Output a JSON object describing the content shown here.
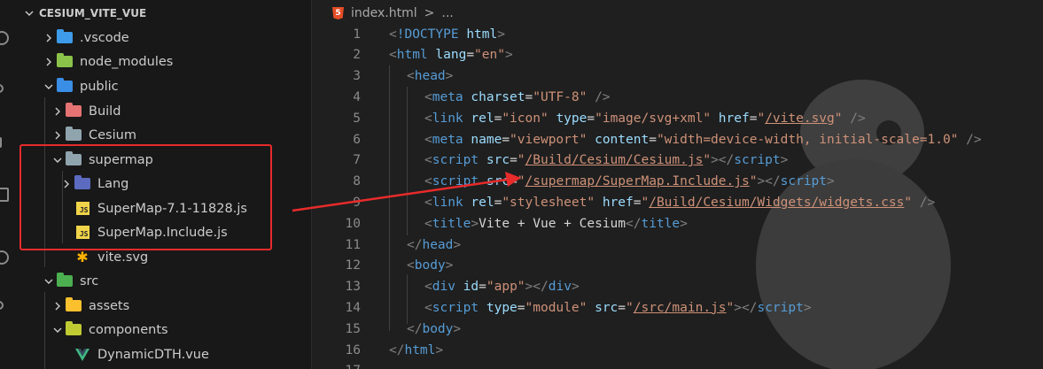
{
  "explorer": {
    "root_label": "CESIUM_VITE_VUE",
    "items": [
      {
        "label": ".vscode",
        "icon": "vscode-folder-icon",
        "chevron": "right"
      },
      {
        "label": "node_modules",
        "icon": "node-folder-icon",
        "chevron": "right"
      },
      {
        "label": "public",
        "icon": "public-folder-icon",
        "chevron": "down"
      },
      {
        "label": "Build",
        "icon": "build-folder-icon",
        "chevron": "right"
      },
      {
        "label": "Cesium",
        "icon": "folder-icon",
        "chevron": "right"
      },
      {
        "label": "supermap",
        "icon": "folder-open-icon",
        "chevron": "down"
      },
      {
        "label": "Lang",
        "icon": "lang-folder-icon",
        "chevron": "right"
      },
      {
        "label": "SuperMap-7.1-11828.js",
        "icon": "js-file-icon",
        "chevron": "none"
      },
      {
        "label": "SuperMap.Include.js",
        "icon": "js-file-icon",
        "chevron": "none"
      },
      {
        "label": "vite.svg",
        "icon": "svg-file-icon",
        "chevron": "none"
      },
      {
        "label": "src",
        "icon": "src-folder-icon",
        "chevron": "down"
      },
      {
        "label": "assets",
        "icon": "assets-folder-icon",
        "chevron": "right"
      },
      {
        "label": "components",
        "icon": "components-folder-icon",
        "chevron": "down"
      },
      {
        "label": "DynamicDTH.vue",
        "icon": "vue-file-icon",
        "chevron": "none"
      }
    ]
  },
  "editor": {
    "breadcrumb_file": "index.html",
    "breadcrumb_sep": ">",
    "breadcrumb_more": "...",
    "lines": [
      {
        "n": "1",
        "s": [
          [
            "punct",
            "<"
          ],
          [
            "tag",
            "!DOCTYPE"
          ],
          [
            "txt",
            " "
          ],
          [
            "attr",
            "html"
          ],
          [
            "punct",
            ">"
          ]
        ]
      },
      {
        "n": "2",
        "s": [
          [
            "punct",
            "<"
          ],
          [
            "tag",
            "html"
          ],
          [
            "txt",
            " "
          ],
          [
            "attr",
            "lang"
          ],
          [
            "txt",
            "="
          ],
          [
            "val",
            "\"en\""
          ],
          [
            "punct",
            ">"
          ]
        ]
      },
      {
        "n": "3",
        "s": [
          [
            "punct",
            "<"
          ],
          [
            "tag",
            "head"
          ],
          [
            "punct",
            ">"
          ]
        ]
      },
      {
        "n": "4",
        "s": [
          [
            "punct",
            "<"
          ],
          [
            "tag",
            "meta"
          ],
          [
            "txt",
            " "
          ],
          [
            "attr",
            "charset"
          ],
          [
            "txt",
            "="
          ],
          [
            "val",
            "\"UTF-8\""
          ],
          [
            "txt",
            " "
          ],
          [
            "punct",
            "/>"
          ]
        ]
      },
      {
        "n": "5",
        "s": [
          [
            "punct",
            "<"
          ],
          [
            "tag",
            "link"
          ],
          [
            "txt",
            " "
          ],
          [
            "attr",
            "rel"
          ],
          [
            "txt",
            "="
          ],
          [
            "val",
            "\"icon\""
          ],
          [
            "txt",
            " "
          ],
          [
            "attr",
            "type"
          ],
          [
            "txt",
            "="
          ],
          [
            "val",
            "\"image/svg+xml\""
          ],
          [
            "txt",
            " "
          ],
          [
            "attr",
            "href"
          ],
          [
            "txt",
            "="
          ],
          [
            "val",
            "\""
          ],
          [
            "valu",
            "/vite.svg"
          ],
          [
            "val",
            "\""
          ],
          [
            "txt",
            " "
          ],
          [
            "punct",
            "/>"
          ]
        ]
      },
      {
        "n": "6",
        "s": [
          [
            "punct",
            "<"
          ],
          [
            "tag",
            "meta"
          ],
          [
            "txt",
            " "
          ],
          [
            "attr",
            "name"
          ],
          [
            "txt",
            "="
          ],
          [
            "val",
            "\"viewport\""
          ],
          [
            "txt",
            " "
          ],
          [
            "attr",
            "content"
          ],
          [
            "txt",
            "="
          ],
          [
            "val",
            "\"width=device-width, initial-scale=1.0\""
          ],
          [
            "txt",
            " "
          ],
          [
            "punct",
            "/>"
          ]
        ]
      },
      {
        "n": "7",
        "s": [
          [
            "punct",
            "<"
          ],
          [
            "tag",
            "script"
          ],
          [
            "txt",
            " "
          ],
          [
            "attr",
            "src"
          ],
          [
            "txt",
            "="
          ],
          [
            "val",
            "\""
          ],
          [
            "valu",
            "/Build/Cesium/Cesium.js"
          ],
          [
            "val",
            "\""
          ],
          [
            "punct",
            "></"
          ],
          [
            "tag",
            "script"
          ],
          [
            "punct",
            ">"
          ]
        ]
      },
      {
        "n": "8",
        "s": [
          [
            "punct",
            "<"
          ],
          [
            "tag",
            "script"
          ],
          [
            "txt",
            " "
          ],
          [
            "attr",
            "src"
          ],
          [
            "txt",
            "="
          ],
          [
            "val",
            "\""
          ],
          [
            "valu",
            "/supermap/SuperMap.Include.js"
          ],
          [
            "val",
            "\""
          ],
          [
            "punct",
            "></"
          ],
          [
            "tag",
            "script"
          ],
          [
            "punct",
            ">"
          ]
        ]
      },
      {
        "n": "9",
        "s": [
          [
            "punct",
            "<"
          ],
          [
            "tag",
            "link"
          ],
          [
            "txt",
            " "
          ],
          [
            "attr",
            "rel"
          ],
          [
            "txt",
            "="
          ],
          [
            "val",
            "\"stylesheet\""
          ],
          [
            "txt",
            " "
          ],
          [
            "attr",
            "href"
          ],
          [
            "txt",
            "="
          ],
          [
            "val",
            "\""
          ],
          [
            "valu",
            "/Build/Cesium/Widgets/widgets.css"
          ],
          [
            "val",
            "\""
          ],
          [
            "txt",
            " "
          ],
          [
            "punct",
            "/>"
          ]
        ]
      },
      {
        "n": "10",
        "s": [
          [
            "punct",
            "<"
          ],
          [
            "tag",
            "title"
          ],
          [
            "punct",
            ">"
          ],
          [
            "txt",
            "Vite + Vue + Cesium"
          ],
          [
            "punct",
            "</"
          ],
          [
            "tag",
            "title"
          ],
          [
            "punct",
            ">"
          ]
        ]
      },
      {
        "n": "11",
        "s": [
          [
            "punct",
            "</"
          ],
          [
            "tag",
            "head"
          ],
          [
            "punct",
            ">"
          ]
        ]
      },
      {
        "n": "12",
        "s": [
          [
            "punct",
            "<"
          ],
          [
            "tag",
            "body"
          ],
          [
            "punct",
            ">"
          ]
        ]
      },
      {
        "n": "13",
        "s": [
          [
            "punct",
            "<"
          ],
          [
            "tag",
            "div"
          ],
          [
            "txt",
            " "
          ],
          [
            "attr",
            "id"
          ],
          [
            "txt",
            "="
          ],
          [
            "val",
            "\"app\""
          ],
          [
            "punct",
            "></"
          ],
          [
            "tag",
            "div"
          ],
          [
            "punct",
            ">"
          ]
        ]
      },
      {
        "n": "14",
        "s": [
          [
            "punct",
            "<"
          ],
          [
            "tag",
            "script"
          ],
          [
            "txt",
            " "
          ],
          [
            "attr",
            "type"
          ],
          [
            "txt",
            "="
          ],
          [
            "val",
            "\"module\""
          ],
          [
            "txt",
            " "
          ],
          [
            "attr",
            "src"
          ],
          [
            "txt",
            "="
          ],
          [
            "val",
            "\""
          ],
          [
            "valu",
            "/src/main.js"
          ],
          [
            "val",
            "\""
          ],
          [
            "punct",
            "></"
          ],
          [
            "tag",
            "script"
          ],
          [
            "punct",
            ">"
          ]
        ]
      },
      {
        "n": "15",
        "s": [
          [
            "punct",
            "</"
          ],
          [
            "tag",
            "body"
          ],
          [
            "punct",
            ">"
          ]
        ]
      },
      {
        "n": "16",
        "s": [
          [
            "punct",
            "</"
          ],
          [
            "tag",
            "html"
          ],
          [
            "punct",
            ">"
          ]
        ]
      },
      {
        "n": "17",
        "s": []
      }
    ]
  },
  "annotation": {
    "color": "#e82b2b"
  }
}
